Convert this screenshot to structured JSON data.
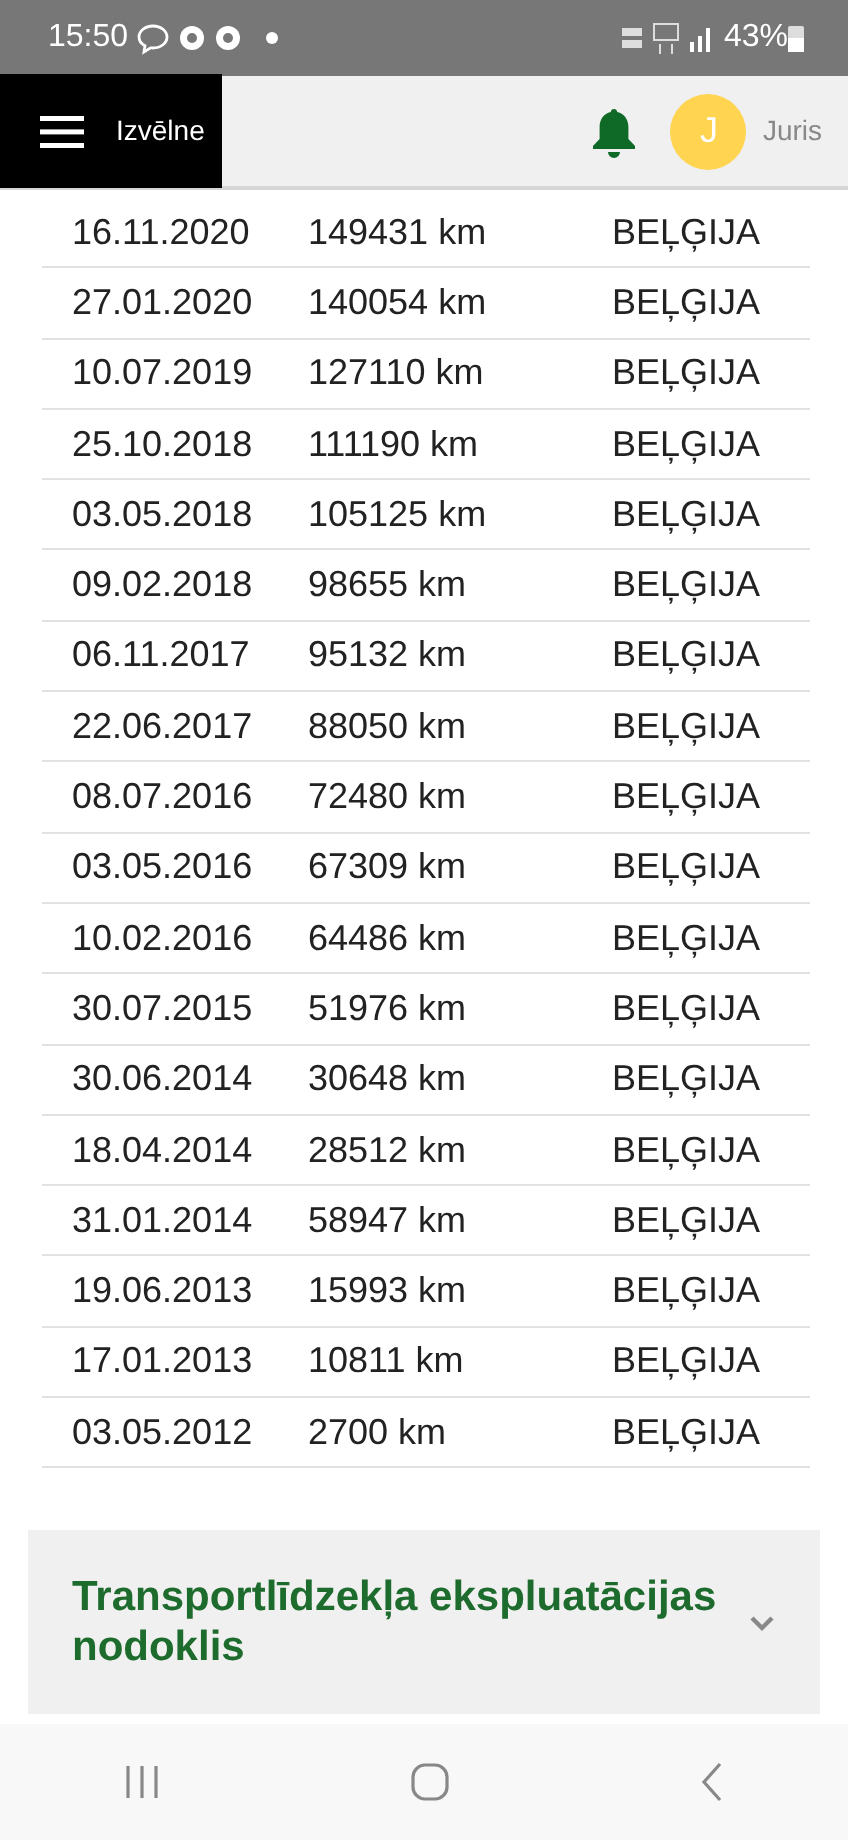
{
  "status_bar": {
    "time": "15:50",
    "battery": "43%"
  },
  "header": {
    "menu_label": "Izvēlne",
    "avatar_initial": "J",
    "user_name": "Juris"
  },
  "table": {
    "rows": [
      {
        "date": "16.11.2020",
        "mileage": "149431 km",
        "country": "BEĻĢIJA"
      },
      {
        "date": "27.01.2020",
        "mileage": "140054 km",
        "country": "BEĻĢIJA"
      },
      {
        "date": "10.07.2019",
        "mileage": "127110 km",
        "country": "BEĻĢIJA"
      },
      {
        "date": "25.10.2018",
        "mileage": "111190 km",
        "country": "BEĻĢIJA"
      },
      {
        "date": "03.05.2018",
        "mileage": "105125 km",
        "country": "BEĻĢIJA"
      },
      {
        "date": "09.02.2018",
        "mileage": "98655 km",
        "country": "BEĻĢIJA"
      },
      {
        "date": "06.11.2017",
        "mileage": "95132 km",
        "country": "BEĻĢIJA"
      },
      {
        "date": "22.06.2017",
        "mileage": "88050 km",
        "country": "BEĻĢIJA"
      },
      {
        "date": "08.07.2016",
        "mileage": "72480 km",
        "country": "BEĻĢIJA"
      },
      {
        "date": "03.05.2016",
        "mileage": "67309 km",
        "country": "BEĻĢIJA"
      },
      {
        "date": "10.02.2016",
        "mileage": "64486 km",
        "country": "BEĻĢIJA"
      },
      {
        "date": "30.07.2015",
        "mileage": "51976 km",
        "country": "BEĻĢIJA"
      },
      {
        "date": "30.06.2014",
        "mileage": "30648 km",
        "country": "BEĻĢIJA"
      },
      {
        "date": "18.04.2014",
        "mileage": "28512 km",
        "country": "BEĻĢIJA"
      },
      {
        "date": "31.01.2014",
        "mileage": "58947 km",
        "country": "BEĻĢIJA"
      },
      {
        "date": "19.06.2013",
        "mileage": "15993 km",
        "country": "BEĻĢIJA"
      },
      {
        "date": "17.01.2013",
        "mileage": "10811 km",
        "country": "BEĻĢIJA"
      },
      {
        "date": "03.05.2012",
        "mileage": "2700 km",
        "country": "BEĻĢIJA"
      }
    ]
  },
  "accordion": {
    "title": "Transportlīdzekļa ekspluatācijas nodoklis",
    "expanded": false
  }
}
